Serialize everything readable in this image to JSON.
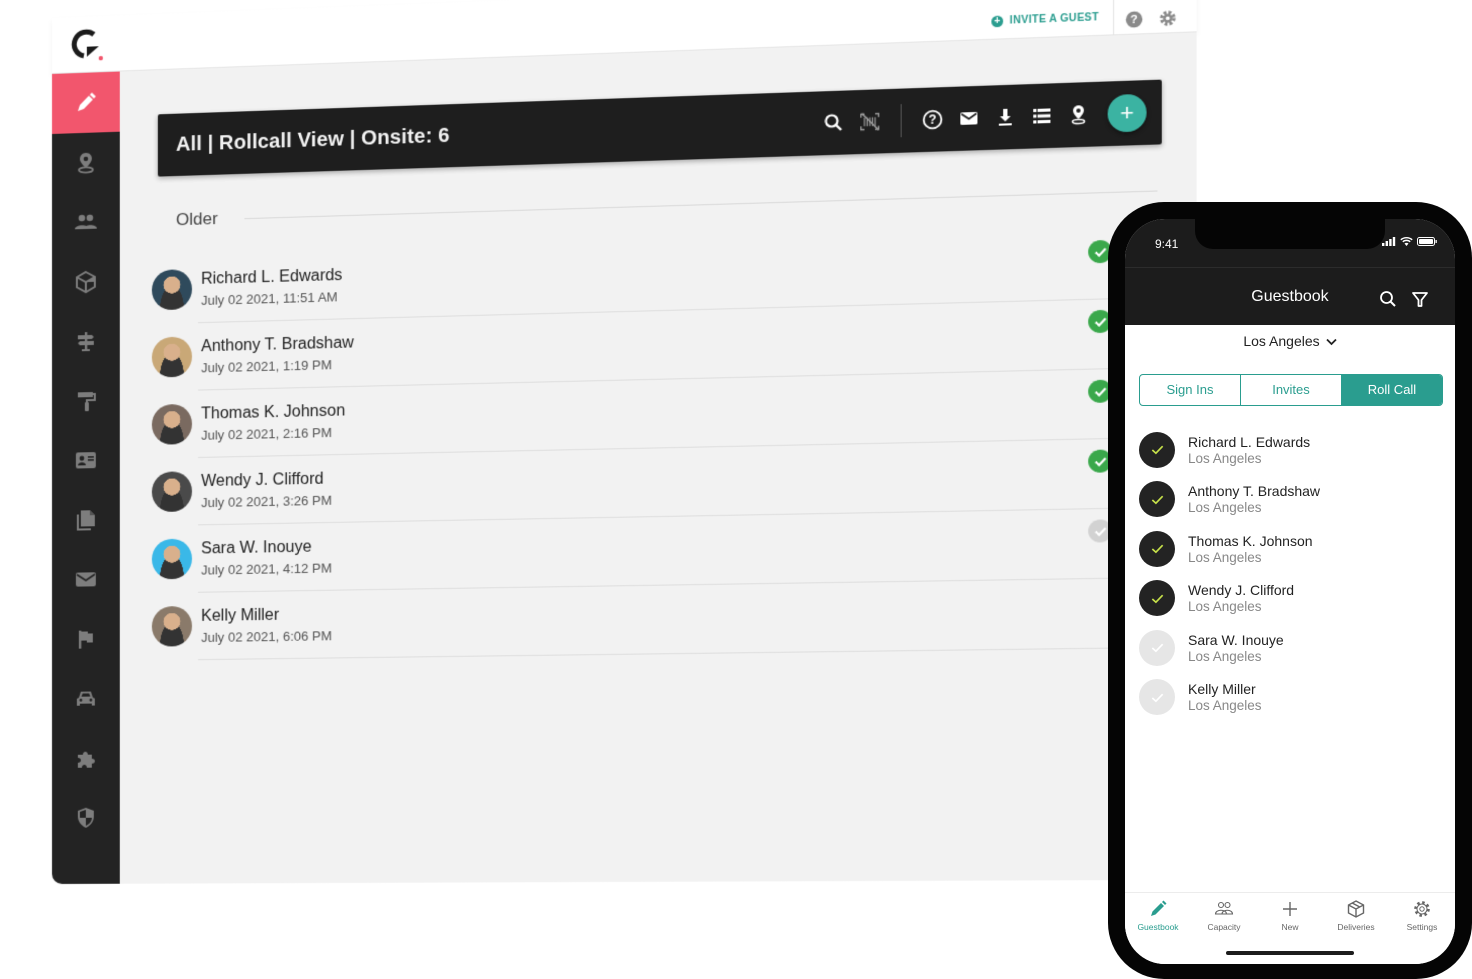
{
  "desktop": {
    "header": {
      "invite_label": "INVITE A GUEST",
      "help_icon": "help-circle-icon",
      "settings_icon": "gear-icon"
    },
    "sidebar": {
      "items": [
        {
          "name": "guestbook",
          "icon": "pen-icon",
          "active": true
        },
        {
          "name": "locations",
          "icon": "map-pin-icon",
          "active": false
        },
        {
          "name": "people",
          "icon": "people-icon",
          "active": false
        },
        {
          "name": "deliveries",
          "icon": "box-icon",
          "active": false
        },
        {
          "name": "wayfinding",
          "icon": "signpost-icon",
          "active": false
        },
        {
          "name": "branding",
          "icon": "paint-roller-icon",
          "active": false
        },
        {
          "name": "badges",
          "icon": "id-card-icon",
          "active": false
        },
        {
          "name": "documents",
          "icon": "documents-icon",
          "active": false
        },
        {
          "name": "messages",
          "icon": "envelope-icon",
          "active": false
        },
        {
          "name": "emergency",
          "icon": "flag-icon",
          "active": false
        },
        {
          "name": "parking",
          "icon": "car-icon",
          "active": false
        },
        {
          "name": "integrations",
          "icon": "puzzle-icon",
          "active": false
        },
        {
          "name": "security",
          "icon": "shield-icon",
          "active": false
        }
      ]
    },
    "toolbar": {
      "title": "All | Rollcall View | Onsite: 6",
      "icons": [
        "search-icon",
        "barcode-off-icon",
        "help-circle-icon",
        "envelope-icon",
        "download-icon",
        "list-icon",
        "map-pin-icon"
      ],
      "fab_label": "+"
    },
    "section_label": "Older",
    "guests": [
      {
        "name": "Richard L. Edwards",
        "time": "July 02 2021, 11:51 AM",
        "checked": true,
        "avatar_color": "#2f4a5c"
      },
      {
        "name": "Anthony T. Bradshaw",
        "time": "July 02 2021, 1:19 PM",
        "checked": true,
        "avatar_color": "#c9a877"
      },
      {
        "name": "Thomas K. Johnson",
        "time": "July 02 2021, 2:16 PM",
        "checked": true,
        "avatar_color": "#7a6a60"
      },
      {
        "name": "Wendy J. Clifford",
        "time": "July 02 2021, 3:26 PM",
        "checked": true,
        "avatar_color": "#4a4a4a"
      },
      {
        "name": "Sara W. Inouye",
        "time": "July 02 2021, 4:12 PM",
        "checked": false,
        "avatar_color": "#3ab8e8"
      },
      {
        "name": "Kelly Miller",
        "time": "July 02 2021, 6:06 PM",
        "checked": null,
        "avatar_color": "#8a7a6a"
      }
    ]
  },
  "phone": {
    "clock": "9:41",
    "title": "Guestbook",
    "location": "Los Angeles",
    "segments": [
      {
        "label": "Sign Ins",
        "active": false
      },
      {
        "label": "Invites",
        "active": false
      },
      {
        "label": "Roll Call",
        "active": true
      }
    ],
    "people": [
      {
        "name": "Richard L. Edwards",
        "location": "Los Angeles",
        "checked": true
      },
      {
        "name": "Anthony T. Bradshaw",
        "location": "Los Angeles",
        "checked": true
      },
      {
        "name": "Thomas K. Johnson",
        "location": "Los Angeles",
        "checked": true
      },
      {
        "name": "Wendy J. Clifford",
        "location": "Los Angeles",
        "checked": true
      },
      {
        "name": "Sara W. Inouye",
        "location": "Los Angeles",
        "checked": false
      },
      {
        "name": "Kelly Miller",
        "location": "Los Angeles",
        "checked": false
      }
    ],
    "tabs": [
      {
        "label": "Guestbook",
        "icon": "pen-icon",
        "active": true
      },
      {
        "label": "Capacity",
        "icon": "people-icon",
        "active": false
      },
      {
        "label": "New",
        "icon": "plus-icon",
        "active": false
      },
      {
        "label": "Deliveries",
        "icon": "box-icon",
        "active": false
      },
      {
        "label": "Settings",
        "icon": "gear-icon",
        "active": false
      }
    ]
  },
  "colors": {
    "accent": "#2a9d8f",
    "brand_pink": "#f2566d",
    "check_green": "#3aa84b",
    "check_lime": "#c6e04a",
    "dark": "#1e1e1e"
  }
}
